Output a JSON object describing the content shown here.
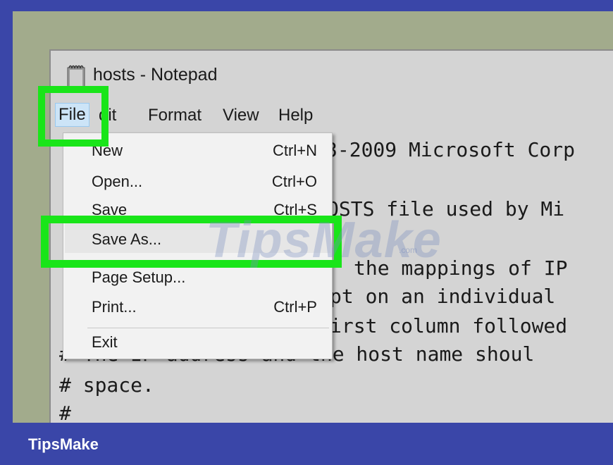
{
  "window": {
    "title": "hosts - Notepad",
    "icon": "notepad-icon"
  },
  "menubar": {
    "items": [
      "File",
      "Edit",
      "Format",
      "View",
      "Help"
    ]
  },
  "menubar_visible": {
    "file": "File",
    "edit": "dit",
    "format": "Format",
    "view": "View",
    "help": "Help"
  },
  "editor": {
    "lines": [
      "3-2009 Microsoft Corp",
      "",
      "OSTS file used by Mi",
      "",
      "the mappings of IP",
      "pt on an individual",
      "irst column followed",
      "# The IP address and the host name shoul",
      "# space.",
      "#"
    ]
  },
  "file_menu": {
    "items": [
      {
        "label": "New",
        "shortcut": "Ctrl+N"
      },
      {
        "label": "Open...",
        "shortcut": "Ctrl+O"
      },
      {
        "label": "Save",
        "shortcut": "Ctrl+S"
      },
      {
        "label": "Save As...",
        "shortcut": ""
      },
      {
        "label": "Page Setup...",
        "shortcut": ""
      },
      {
        "label": "Print...",
        "shortcut": "Ctrl+P"
      },
      {
        "label": "Exit",
        "shortcut": ""
      }
    ]
  },
  "watermark": {
    "text": "TipsMake",
    "suffix": ".com"
  },
  "footer": {
    "brand": "TipsMake"
  },
  "colors": {
    "highlight": "#19e519",
    "frame": "#3a46a8",
    "desktop": "#a2ab8c"
  }
}
